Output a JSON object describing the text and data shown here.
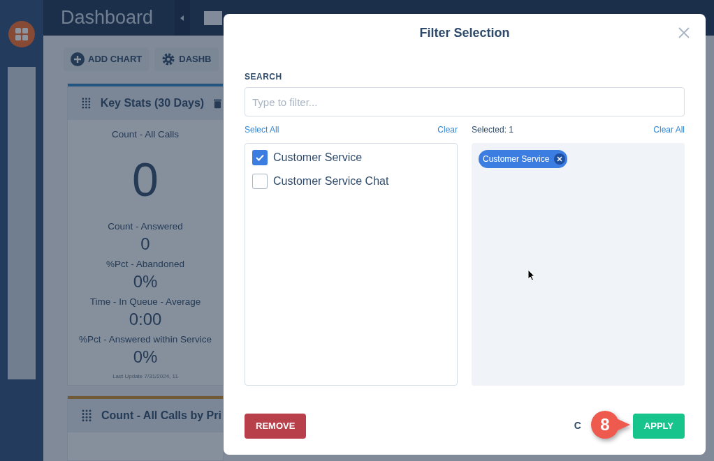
{
  "header": {
    "title": "Dashboard"
  },
  "toolbar": {
    "buttons": [
      {
        "label": "ADD CHART",
        "kind": "add"
      },
      {
        "label": "DASHB",
        "kind": "settings"
      }
    ]
  },
  "cards": [
    {
      "title": "Key Stats (30 Days)",
      "color": "#245480",
      "stats": [
        {
          "label": "Count - All Calls",
          "value": "0",
          "kind": "big"
        },
        {
          "label": "Count - Answered",
          "value": "0",
          "kind": "normal"
        },
        {
          "label": "%Pct - Abandoned",
          "value": "0%",
          "kind": "normal"
        },
        {
          "label": "Time - In Queue - Average",
          "value": "0:00",
          "kind": "normal"
        },
        {
          "label": "%Pct - Answered within Service",
          "value": "0%",
          "kind": "normal"
        }
      ],
      "footer": "Last Update 7/31/2024, 11"
    },
    {
      "title": "Count - All Calls by Pri",
      "color": "#715a37"
    }
  ],
  "modal": {
    "title": "Filter Selection",
    "search_label": "SEARCH",
    "search": {
      "placeholder": "Type to filter..."
    },
    "select_all": "Select All",
    "clear": "Clear",
    "selected_count": "Selected: 1",
    "clear_all": "Clear All",
    "options": [
      {
        "label": "Customer Service",
        "checked": true
      },
      {
        "label": "Customer Service Chat",
        "checked": false
      }
    ],
    "chips": [
      {
        "label": "Customer Service"
      }
    ],
    "buttons": [
      {
        "label": "REMOVE",
        "kind": "danger"
      },
      {
        "label": "C",
        "kind": "link"
      },
      {
        "label": "APPLY",
        "kind": "primary"
      }
    ]
  },
  "callout": {
    "label": "8"
  }
}
